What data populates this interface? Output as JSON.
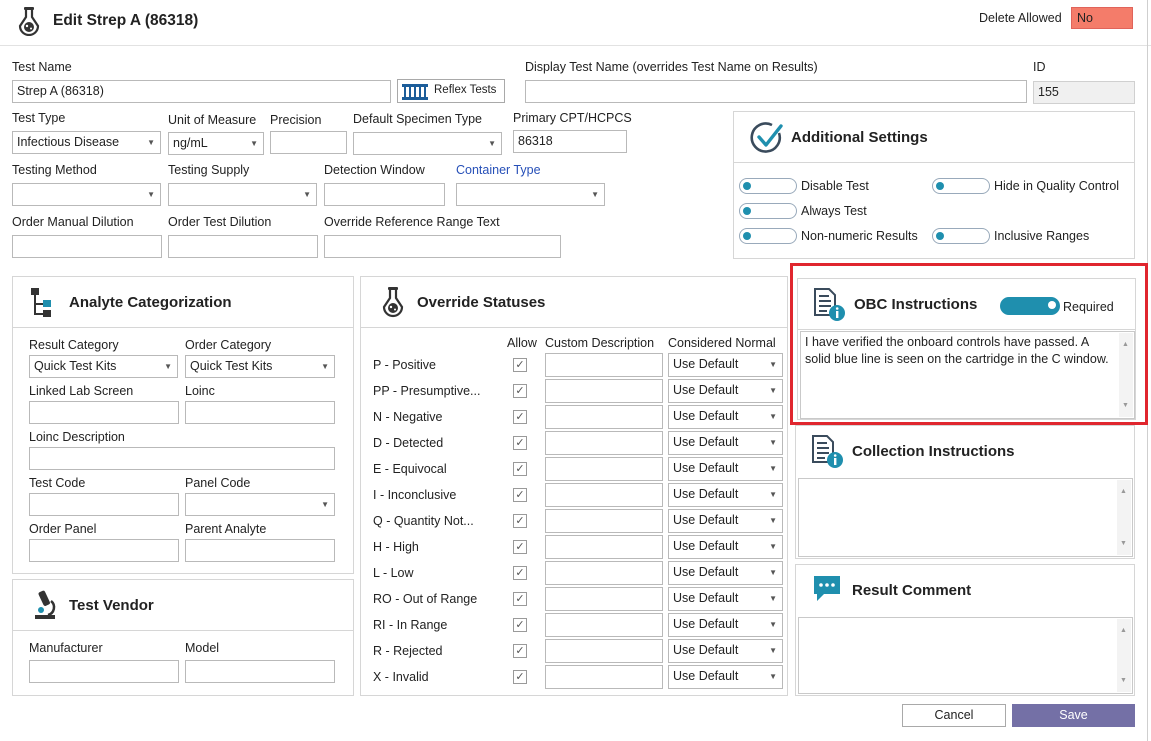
{
  "header": {
    "title": "Edit Strep A (86318)",
    "delete_allowed_label": "Delete Allowed",
    "delete_allowed_value": "No"
  },
  "fields": {
    "test_name": {
      "label": "Test Name",
      "value": "Strep A (86318)"
    },
    "reflex_tests_button": "Reflex Tests",
    "display_test_name": {
      "label": "Display Test Name (overrides Test Name on Results)",
      "value": ""
    },
    "id": {
      "label": "ID",
      "value": "155"
    },
    "test_type": {
      "label": "Test Type",
      "value": "Infectious Disease"
    },
    "unit_of_measure": {
      "label": "Unit of Measure",
      "value": "ng/mL"
    },
    "precision": {
      "label": "Precision",
      "value": ""
    },
    "default_specimen_type": {
      "label": "Default Specimen Type",
      "value": ""
    },
    "primary_cpt": {
      "label": "Primary CPT/HCPCS",
      "value": "86318"
    },
    "testing_method": {
      "label": "Testing Method",
      "value": ""
    },
    "testing_supply": {
      "label": "Testing Supply",
      "value": ""
    },
    "detection_window": {
      "label": "Detection Window",
      "value": ""
    },
    "container_type": {
      "label": "Container Type",
      "value": ""
    },
    "order_manual_dilution": {
      "label": "Order Manual Dilution",
      "value": ""
    },
    "order_test_dilution": {
      "label": "Order Test Dilution",
      "value": ""
    },
    "override_reference_range": {
      "label": "Override Reference Range Text",
      "value": ""
    }
  },
  "additional_settings": {
    "title": "Additional Settings",
    "toggles": {
      "disable_test": "Disable Test",
      "hide_qc": "Hide in Quality Control",
      "always_test": "Always Test",
      "non_numeric": "Non-numeric Results",
      "inclusive_ranges": "Inclusive Ranges"
    }
  },
  "analyte": {
    "title": "Analyte Categorization",
    "result_category": {
      "label": "Result Category",
      "value": "Quick Test Kits"
    },
    "order_category": {
      "label": "Order Category",
      "value": "Quick Test Kits"
    },
    "linked_lab_screen": {
      "label": "Linked Lab Screen",
      "value": ""
    },
    "loinc": {
      "label": "Loinc",
      "value": ""
    },
    "loinc_description": {
      "label": "Loinc Description",
      "value": ""
    },
    "test_code": {
      "label": "Test Code",
      "value": ""
    },
    "panel_code": {
      "label": "Panel Code",
      "value": ""
    },
    "order_panel": {
      "label": "Order Panel",
      "value": ""
    },
    "parent_analyte": {
      "label": "Parent Analyte",
      "value": ""
    }
  },
  "vendor": {
    "title": "Test Vendor",
    "manufacturer": {
      "label": "Manufacturer",
      "value": ""
    },
    "model": {
      "label": "Model",
      "value": ""
    }
  },
  "statuses": {
    "title": "Override Statuses",
    "col_allow": "Allow",
    "col_custom": "Custom Description",
    "col_normal": "Considered Normal",
    "rows": [
      {
        "name": "P - Positive",
        "normal": "Use Default"
      },
      {
        "name": "PP - Presumptive...",
        "normal": "Use Default"
      },
      {
        "name": "N - Negative",
        "normal": "Use Default"
      },
      {
        "name": "D - Detected",
        "normal": "Use Default"
      },
      {
        "name": "E - Equivocal",
        "normal": "Use Default"
      },
      {
        "name": "I - Inconclusive",
        "normal": "Use Default"
      },
      {
        "name": "Q - Quantity Not...",
        "normal": "Use Default"
      },
      {
        "name": "H - High",
        "normal": "Use Default"
      },
      {
        "name": "L - Low",
        "normal": "Use Default"
      },
      {
        "name": "RO - Out of Range",
        "normal": "Use Default"
      },
      {
        "name": "RI - In Range",
        "normal": "Use Default"
      },
      {
        "name": "R - Rejected",
        "normal": "Use Default"
      },
      {
        "name": "X - Invalid",
        "normal": "Use Default"
      }
    ]
  },
  "obc": {
    "title": "OBC Instructions",
    "required_label": "Required",
    "text": "I have verified the onboard controls have passed.  A solid blue line is seen on the cartridge in the C window."
  },
  "collection": {
    "title": "Collection Instructions",
    "text": ""
  },
  "result_comment": {
    "title": "Result Comment",
    "text": ""
  },
  "footer": {
    "cancel": "Cancel",
    "save": "Save"
  },
  "colors": {
    "accent": "#1f8fae",
    "highlight": "#e0262e",
    "save_button": "#7470a6",
    "no_badge": "#f47c6a"
  }
}
